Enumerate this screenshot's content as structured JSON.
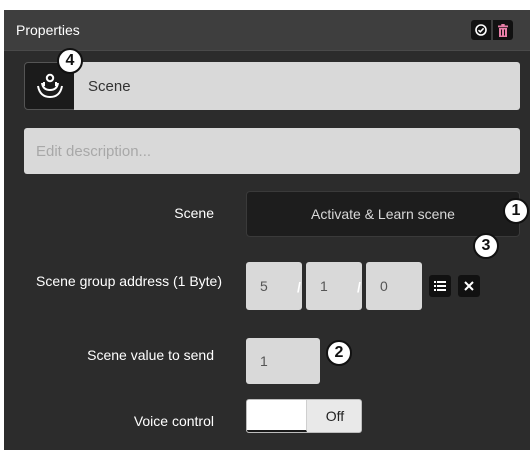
{
  "panel": {
    "title": "Properties",
    "actions": [
      {
        "icon": "check-circle-icon",
        "color": "#ffffff"
      },
      {
        "icon": "trash-icon",
        "color": "#e87fa8"
      }
    ]
  },
  "object": {
    "icon": "scene-icon",
    "name": "Scene",
    "description_placeholder": "Edit description..."
  },
  "fields": {
    "scene_label": "Scene",
    "activate_button": "Activate & Learn scene",
    "group_address_label": "Scene group address (1 Byte)",
    "group_address": [
      "5",
      "1",
      "0"
    ],
    "separator": "/",
    "value_label": "Scene value to send",
    "value": "1",
    "voice_label": "Voice control",
    "voice_state": "Off"
  },
  "callouts": [
    "4",
    "1",
    "3",
    "2"
  ],
  "colors": {
    "panel_bg": "#2c2c2c",
    "titlebar_bg": "#3e3e3e",
    "field_bg": "#d9d9d9",
    "button_bg": "#1d1d1d"
  }
}
